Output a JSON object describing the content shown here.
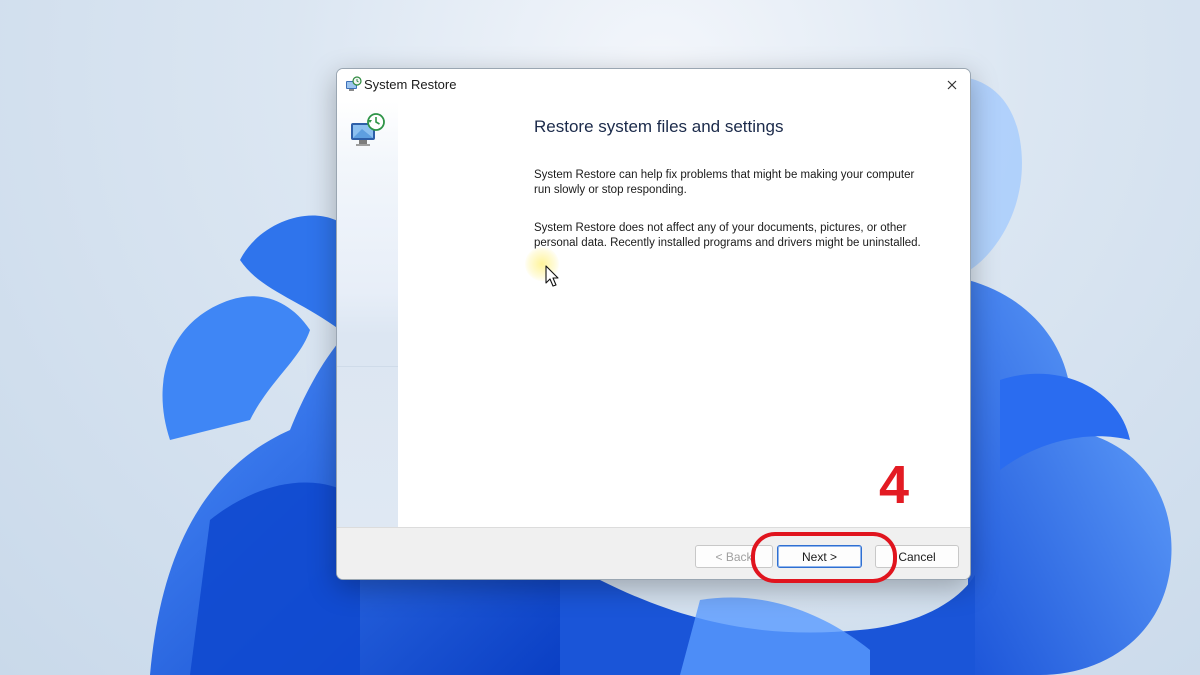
{
  "window": {
    "title": "System Restore",
    "close_glyph": "✕"
  },
  "content": {
    "heading": "Restore system files and settings",
    "paragraph1": "System Restore can help fix problems that might be making your computer run slowly or stop responding.",
    "paragraph2": "System Restore does not affect any of your documents, pictures, or other personal data. Recently installed programs and drivers might be uninstalled."
  },
  "buttons": {
    "back": "< Back",
    "next": "Next >",
    "cancel": "Cancel"
  },
  "annotation": {
    "step_number": "4",
    "color": "#e31b23"
  },
  "icons": {
    "title_icon": "system-restore-icon",
    "sidebar_icon": "system-restore-large-icon",
    "close": "close-icon"
  },
  "colors": {
    "accent": "#2f6fd1",
    "wallpaper_blue": "#1f62e0"
  }
}
